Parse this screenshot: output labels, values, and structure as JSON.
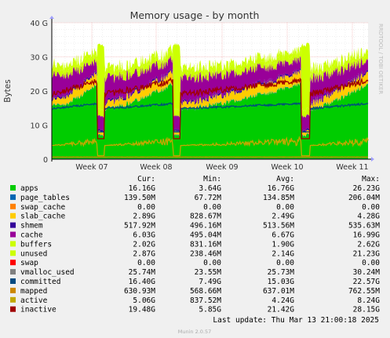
{
  "chart_data": {
    "type": "area",
    "title": "Memory usage - by month",
    "ylabel": "Bytes",
    "watermark": "RRDTOOL / TOBI OETIKER",
    "footer": "Munin 2.0.57",
    "last_update": "Last update: Thu Mar 13 21:00:18 2025",
    "ylim": [
      0,
      40
    ],
    "yunit": "G",
    "yticks": [
      "0",
      "10 G",
      "20 G",
      "30 G",
      "40 G"
    ],
    "xticks": [
      "Week 07",
      "Week 08",
      "Week 09",
      "Week 10",
      "Week 11"
    ],
    "grid": true,
    "table_headers": [
      "Cur:",
      "Min:",
      "Avg:",
      "Max:"
    ],
    "stack_order": [
      "apps",
      "page_tables",
      "swap_cache",
      "slab_cache",
      "shmem",
      "cache",
      "buffers",
      "unused",
      "swap"
    ],
    "series": [
      {
        "name": "apps",
        "color": "#00CC00",
        "cur": "16.16G",
        "min": "3.64G",
        "avg": "16.76G",
        "max": "26.23G"
      },
      {
        "name": "page_tables",
        "color": "#0066B3",
        "cur": "139.50M",
        "min": "67.72M",
        "avg": "134.85M",
        "max": "206.04M"
      },
      {
        "name": "swap_cache",
        "color": "#FF8000",
        "cur": "0.00",
        "min": "0.00",
        "avg": "0.00",
        "max": "0.00"
      },
      {
        "name": "slab_cache",
        "color": "#FFCC00",
        "cur": "2.89G",
        "min": "828.67M",
        "avg": "2.49G",
        "max": "4.28G"
      },
      {
        "name": "shmem",
        "color": "#330099",
        "cur": "517.92M",
        "min": "496.16M",
        "avg": "513.56M",
        "max": "535.63M"
      },
      {
        "name": "cache",
        "color": "#990099",
        "cur": "6.03G",
        "min": "495.04M",
        "avg": "6.67G",
        "max": "16.99G"
      },
      {
        "name": "buffers",
        "color": "#CCFF00",
        "cur": "2.02G",
        "min": "831.16M",
        "avg": "1.90G",
        "max": "2.62G"
      },
      {
        "name": "unused",
        "color": "#CCFF00",
        "cur": "2.87G",
        "min": "238.46M",
        "avg": "2.14G",
        "max": "21.23G"
      },
      {
        "name": "swap",
        "color": "#FF0000",
        "cur": "0.00",
        "min": "0.00",
        "avg": "0.00",
        "max": "0.00"
      },
      {
        "name": "vmalloc_used",
        "color": "#808080",
        "cur": "25.74M",
        "min": "23.55M",
        "avg": "25.73M",
        "max": "30.24M"
      },
      {
        "name": "committed",
        "color": "#004A80",
        "cur": "16.40G",
        "min": "7.49G",
        "avg": "15.03G",
        "max": "22.57G"
      },
      {
        "name": "mapped",
        "color": "#CC8800",
        "cur": "630.93M",
        "min": "568.66M",
        "avg": "637.01M",
        "max": "762.55M"
      },
      {
        "name": "active",
        "color": "#C2A800",
        "cur": "5.06G",
        "min": "837.52M",
        "avg": "4.24G",
        "max": "8.24G"
      },
      {
        "name": "inactive",
        "color": "#A00000",
        "cur": "19.48G",
        "min": "5.85G",
        "avg": "21.42G",
        "max": "28.15G"
      }
    ]
  }
}
